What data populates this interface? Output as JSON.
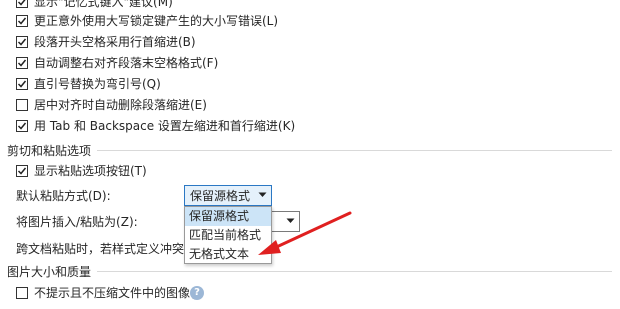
{
  "options": [
    {
      "label": "显示\"记忆式键入\"建议(M)",
      "checked": true
    },
    {
      "label": "更正意外使用大写锁定键产生的大小写错误(L)",
      "checked": true
    },
    {
      "label": "段落开头空格采用行首缩进(B)",
      "checked": true
    },
    {
      "label": "自动调整右对齐段落末空格格式(F)",
      "checked": true
    },
    {
      "label": "直引号替换为弯引号(Q)",
      "checked": true
    },
    {
      "label": "居中对齐时自动删除段落缩进(E)",
      "checked": false
    },
    {
      "label": "用 Tab 和 Backspace 设置左缩进和首行缩进(K)",
      "checked": true
    }
  ],
  "cut_paste": {
    "section_title": "剪切和粘贴选项",
    "show_paste_button": {
      "label": "显示粘贴选项按钮(T)",
      "checked": true
    },
    "default_paste_label": "默认粘贴方式(D):",
    "default_paste_value": "保留源格式",
    "insert_picture_label": "将图片插入/粘贴为(Z):",
    "cross_doc_label": "跨文档粘贴时，若样式定义冲突(Y):",
    "dropdown_options": [
      "保留源格式",
      "匹配当前格式",
      "无格式文本"
    ]
  },
  "image_quality": {
    "section_title": "图片大小和质量",
    "no_compress": {
      "label": "不提示且不压缩文件中的图像(J)",
      "checked": false
    }
  },
  "colors": {
    "annotation_arrow": "#e02020",
    "combo_focus_border": "#2b78c4",
    "selected_item_bg": "#cce4f7"
  }
}
